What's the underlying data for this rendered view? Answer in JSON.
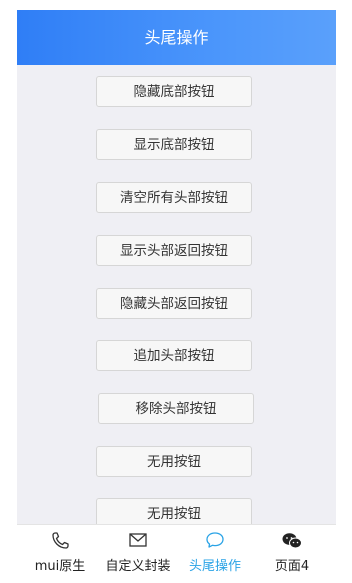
{
  "header": {
    "title": "头尾操作"
  },
  "buttons": [
    "隐藏底部按钮",
    "显示底部按钮",
    "清空所有头部按钮",
    "显示头部返回按钮",
    "隐藏头部返回按钮",
    "追加头部按钮",
    "移除头部按钮",
    "无用按钮",
    "无用按钮"
  ],
  "tabbar": {
    "tabs": [
      {
        "label": "mui原生",
        "icon": "phone-icon"
      },
      {
        "label": "自定义封装",
        "icon": "mail-icon"
      },
      {
        "label": "头尾操作",
        "icon": "chat-bubble-icon",
        "active": true
      },
      {
        "label": "页面4",
        "icon": "wechat-icon"
      }
    ],
    "active_color": "#2aa3e6"
  }
}
